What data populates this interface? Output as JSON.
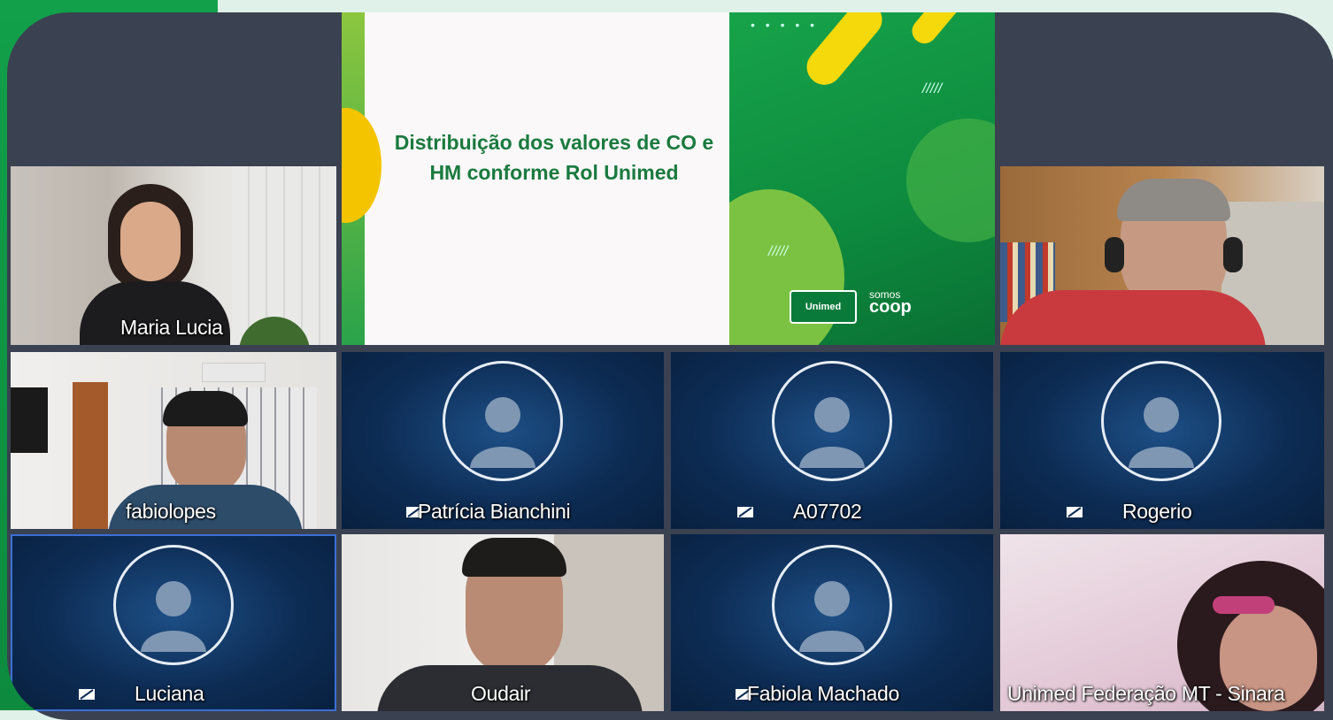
{
  "presentation": {
    "title_line1": "Distribuição dos valores de CO e",
    "title_line2": "HM conforme Rol Unimed",
    "logo_text": "Unimed",
    "somos_label": "somos",
    "coop_label": "coop"
  },
  "participants": [
    {
      "name": "Maria Lucia"
    },
    {
      "name": "fabiolopes"
    },
    {
      "name": "Patrícia Bianchini"
    },
    {
      "name": "A07702"
    },
    {
      "name": "Rogerio"
    },
    {
      "name": "Luciana"
    },
    {
      "name": "Oudair"
    },
    {
      "name": "Fabiola Machado"
    },
    {
      "name": "Unimed Federação MT - Sinara"
    }
  ],
  "icons": {
    "muted_mic": "muted-mic-icon",
    "avatar": "avatar-placeholder-icon"
  },
  "colors": {
    "brand_green": "#12a04a",
    "frame_gray": "#3a4150",
    "tile_blue": "#0d2c54",
    "active_border": "#3b6fd6"
  }
}
